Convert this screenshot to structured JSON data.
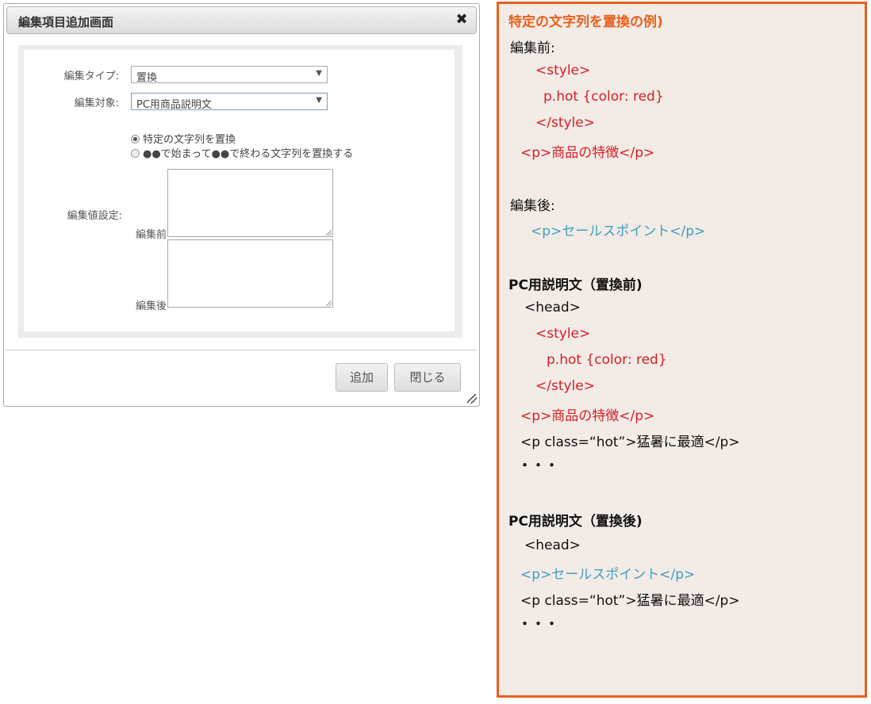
{
  "dialog": {
    "title": "編集項目追加画面",
    "close_icon": "✖",
    "edit_type_label": "編集タイプ:",
    "edit_type_value": "置換",
    "edit_target_label": "編集対象:",
    "edit_target_value": "PC用商品説明文",
    "dropdown_arrow": "▼",
    "radio_options": [
      {
        "label": "特定の文字列を置換",
        "checked": true
      },
      {
        "label": "●●で始まって●●で終わる文字列を置換する",
        "checked": false
      }
    ],
    "value_setting_label": "編集値設定:",
    "before_label": "編集前",
    "after_label": "編集後",
    "add_button": "追加",
    "close_button": "閉じる"
  },
  "note": {
    "heading": "特定の文字列を置換の例)",
    "before_heading": "編集前:",
    "before_lines": [
      "<style>",
      "p.hot {color: red}",
      "</style>",
      "<p>商品の特徴</p>"
    ],
    "after_heading": "編集後:",
    "after_line": "<p>セールスポイント</p>",
    "pc_before_heading": "PC用説明文（置換前)",
    "pc_before_lines": [
      "<head>",
      "<style>",
      "p.hot {color: red}",
      "</style>",
      "<p>商品の特徴</p>",
      "<p class=“hot”>猛暑に最適</p>",
      "・・・"
    ],
    "pc_after_heading": "PC用説明文（置換後)",
    "pc_after_lines": [
      "<head>",
      "<p>セールスポイント</p>",
      "<p class=“hot”>猛暑に最適</p>",
      "・・・"
    ],
    "colors": {
      "border": "#e8601c",
      "background": "#f3ebe6",
      "red": "#d61f26",
      "blue": "#3f9fbf"
    }
  }
}
